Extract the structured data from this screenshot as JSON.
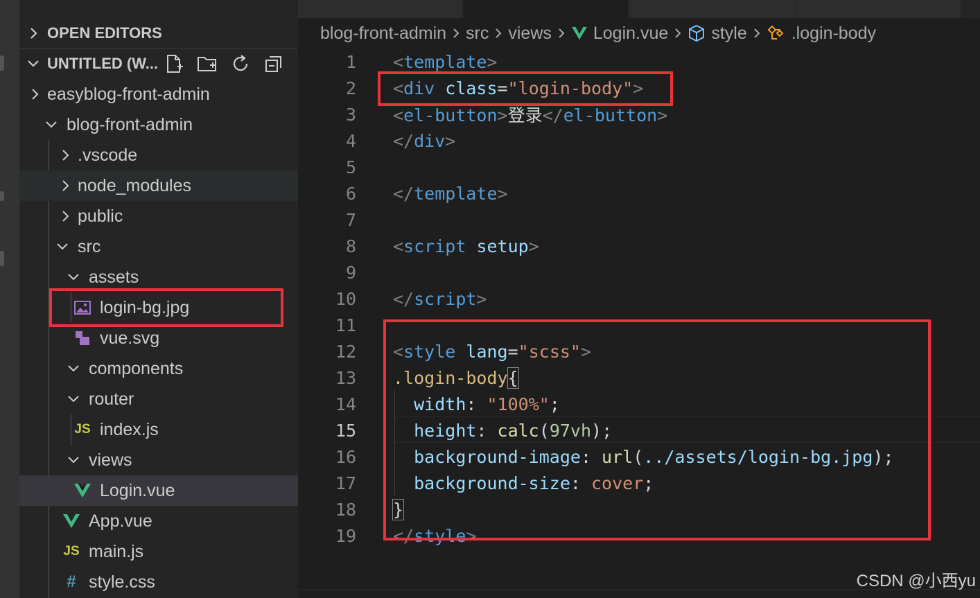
{
  "sidebar": {
    "open_editors_label": "OPEN EDITORS",
    "workspace_label": "UNTITLED (W...",
    "items": [
      {
        "label": "easyblog-front-admin"
      },
      {
        "label": "blog-front-admin"
      },
      {
        "label": ".vscode"
      },
      {
        "label": "node_modules"
      },
      {
        "label": "public"
      },
      {
        "label": "src"
      },
      {
        "label": "assets"
      },
      {
        "label": "login-bg.jpg"
      },
      {
        "label": "vue.svg"
      },
      {
        "label": "components"
      },
      {
        "label": "router"
      },
      {
        "label": "index.js"
      },
      {
        "label": "views"
      },
      {
        "label": "Login.vue"
      },
      {
        "label": "App.vue"
      },
      {
        "label": "main.js"
      },
      {
        "label": "style.css"
      }
    ],
    "icons": {
      "js": "JS",
      "css": "#"
    }
  },
  "breadcrumb": [
    "blog-front-admin",
    "src",
    "views",
    "Login.vue",
    "style",
    ".login-body"
  ],
  "code": {
    "lines": [
      {
        "n": "1",
        "tokens": [
          [
            "<",
            "t-punc"
          ],
          [
            "template",
            "t-tag"
          ],
          [
            ">",
            "t-punc"
          ]
        ]
      },
      {
        "n": "2",
        "tokens": [
          [
            "<",
            "t-punc"
          ],
          [
            "div",
            "t-tag"
          ],
          [
            " ",
            "t-plain"
          ],
          [
            "class",
            "t-attr"
          ],
          [
            "=",
            "t-plain"
          ],
          [
            "\"login-body\"",
            "t-str"
          ],
          [
            ">",
            "t-punc"
          ]
        ]
      },
      {
        "n": "3",
        "tokens": [
          [
            "<",
            "t-punc"
          ],
          [
            "el-button",
            "t-tag"
          ],
          [
            ">",
            "t-punc"
          ],
          [
            "登录",
            "t-plain"
          ],
          [
            "</",
            "t-punc"
          ],
          [
            "el-button",
            "t-tag"
          ],
          [
            ">",
            "t-punc"
          ]
        ]
      },
      {
        "n": "4",
        "tokens": [
          [
            "</",
            "t-punc"
          ],
          [
            "div",
            "t-tag"
          ],
          [
            ">",
            "t-punc"
          ]
        ]
      },
      {
        "n": "5",
        "tokens": []
      },
      {
        "n": "6",
        "tokens": [
          [
            "</",
            "t-punc"
          ],
          [
            "template",
            "t-tag"
          ],
          [
            ">",
            "t-punc"
          ]
        ]
      },
      {
        "n": "7",
        "tokens": []
      },
      {
        "n": "8",
        "tokens": [
          [
            "<",
            "t-punc"
          ],
          [
            "script",
            "t-tag"
          ],
          [
            " ",
            "t-plain"
          ],
          [
            "setup",
            "t-attr"
          ],
          [
            ">",
            "t-punc"
          ]
        ]
      },
      {
        "n": "9",
        "tokens": []
      },
      {
        "n": "10",
        "tokens": [
          [
            "</",
            "t-punc"
          ],
          [
            "script",
            "t-tag"
          ],
          [
            ">",
            "t-punc"
          ]
        ]
      },
      {
        "n": "11",
        "tokens": []
      },
      {
        "n": "12",
        "tokens": [
          [
            "<",
            "t-punc"
          ],
          [
            "style",
            "t-tag"
          ],
          [
            " ",
            "t-plain"
          ],
          [
            "lang",
            "t-attr"
          ],
          [
            "=",
            "t-plain"
          ],
          [
            "\"scss\"",
            "t-str"
          ],
          [
            ">",
            "t-punc"
          ]
        ]
      },
      {
        "n": "13",
        "tokens": [
          [
            ".login-body",
            "t-sel"
          ],
          [
            "{",
            "t-brace"
          ]
        ]
      },
      {
        "n": "14",
        "tokens": [
          [
            "  ",
            "t-plain"
          ],
          [
            "width",
            "t-prop"
          ],
          [
            ": ",
            "t-plain"
          ],
          [
            "\"100%\"",
            "t-str"
          ],
          [
            ";",
            "t-plain"
          ]
        ]
      },
      {
        "n": "15",
        "tokens": [
          [
            "  ",
            "t-plain"
          ],
          [
            "height",
            "t-prop"
          ],
          [
            ": ",
            "t-plain"
          ],
          [
            "calc",
            "t-fn"
          ],
          [
            "(",
            "t-plain"
          ],
          [
            "97vh",
            "t-num"
          ],
          [
            ");",
            "t-plain"
          ]
        ]
      },
      {
        "n": "16",
        "tokens": [
          [
            "  ",
            "t-plain"
          ],
          [
            "background-image",
            "t-prop"
          ],
          [
            ": ",
            "t-plain"
          ],
          [
            "url",
            "t-fn"
          ],
          [
            "(",
            "t-plain"
          ],
          [
            "../assets/login-bg.jpg",
            "t-prop"
          ],
          [
            ");",
            "t-plain"
          ]
        ]
      },
      {
        "n": "17",
        "tokens": [
          [
            "  ",
            "t-plain"
          ],
          [
            "background-size",
            "t-prop"
          ],
          [
            ": ",
            "t-plain"
          ],
          [
            "cover",
            "t-str"
          ],
          [
            ";",
            "t-plain"
          ]
        ]
      },
      {
        "n": "18",
        "tokens": [
          [
            "}",
            "t-brace"
          ]
        ]
      },
      {
        "n": "19",
        "tokens": [
          [
            "</",
            "t-punc"
          ],
          [
            "style",
            "t-tag"
          ],
          [
            ">",
            "t-punc"
          ]
        ]
      }
    ],
    "current_line": "15"
  },
  "watermark": "CSDN @小西yu",
  "colors": {
    "highlight_box": "#e8323c",
    "vue_green": "#41b883",
    "js_yellow": "#cbcb41",
    "css_blue": "#519aba"
  }
}
